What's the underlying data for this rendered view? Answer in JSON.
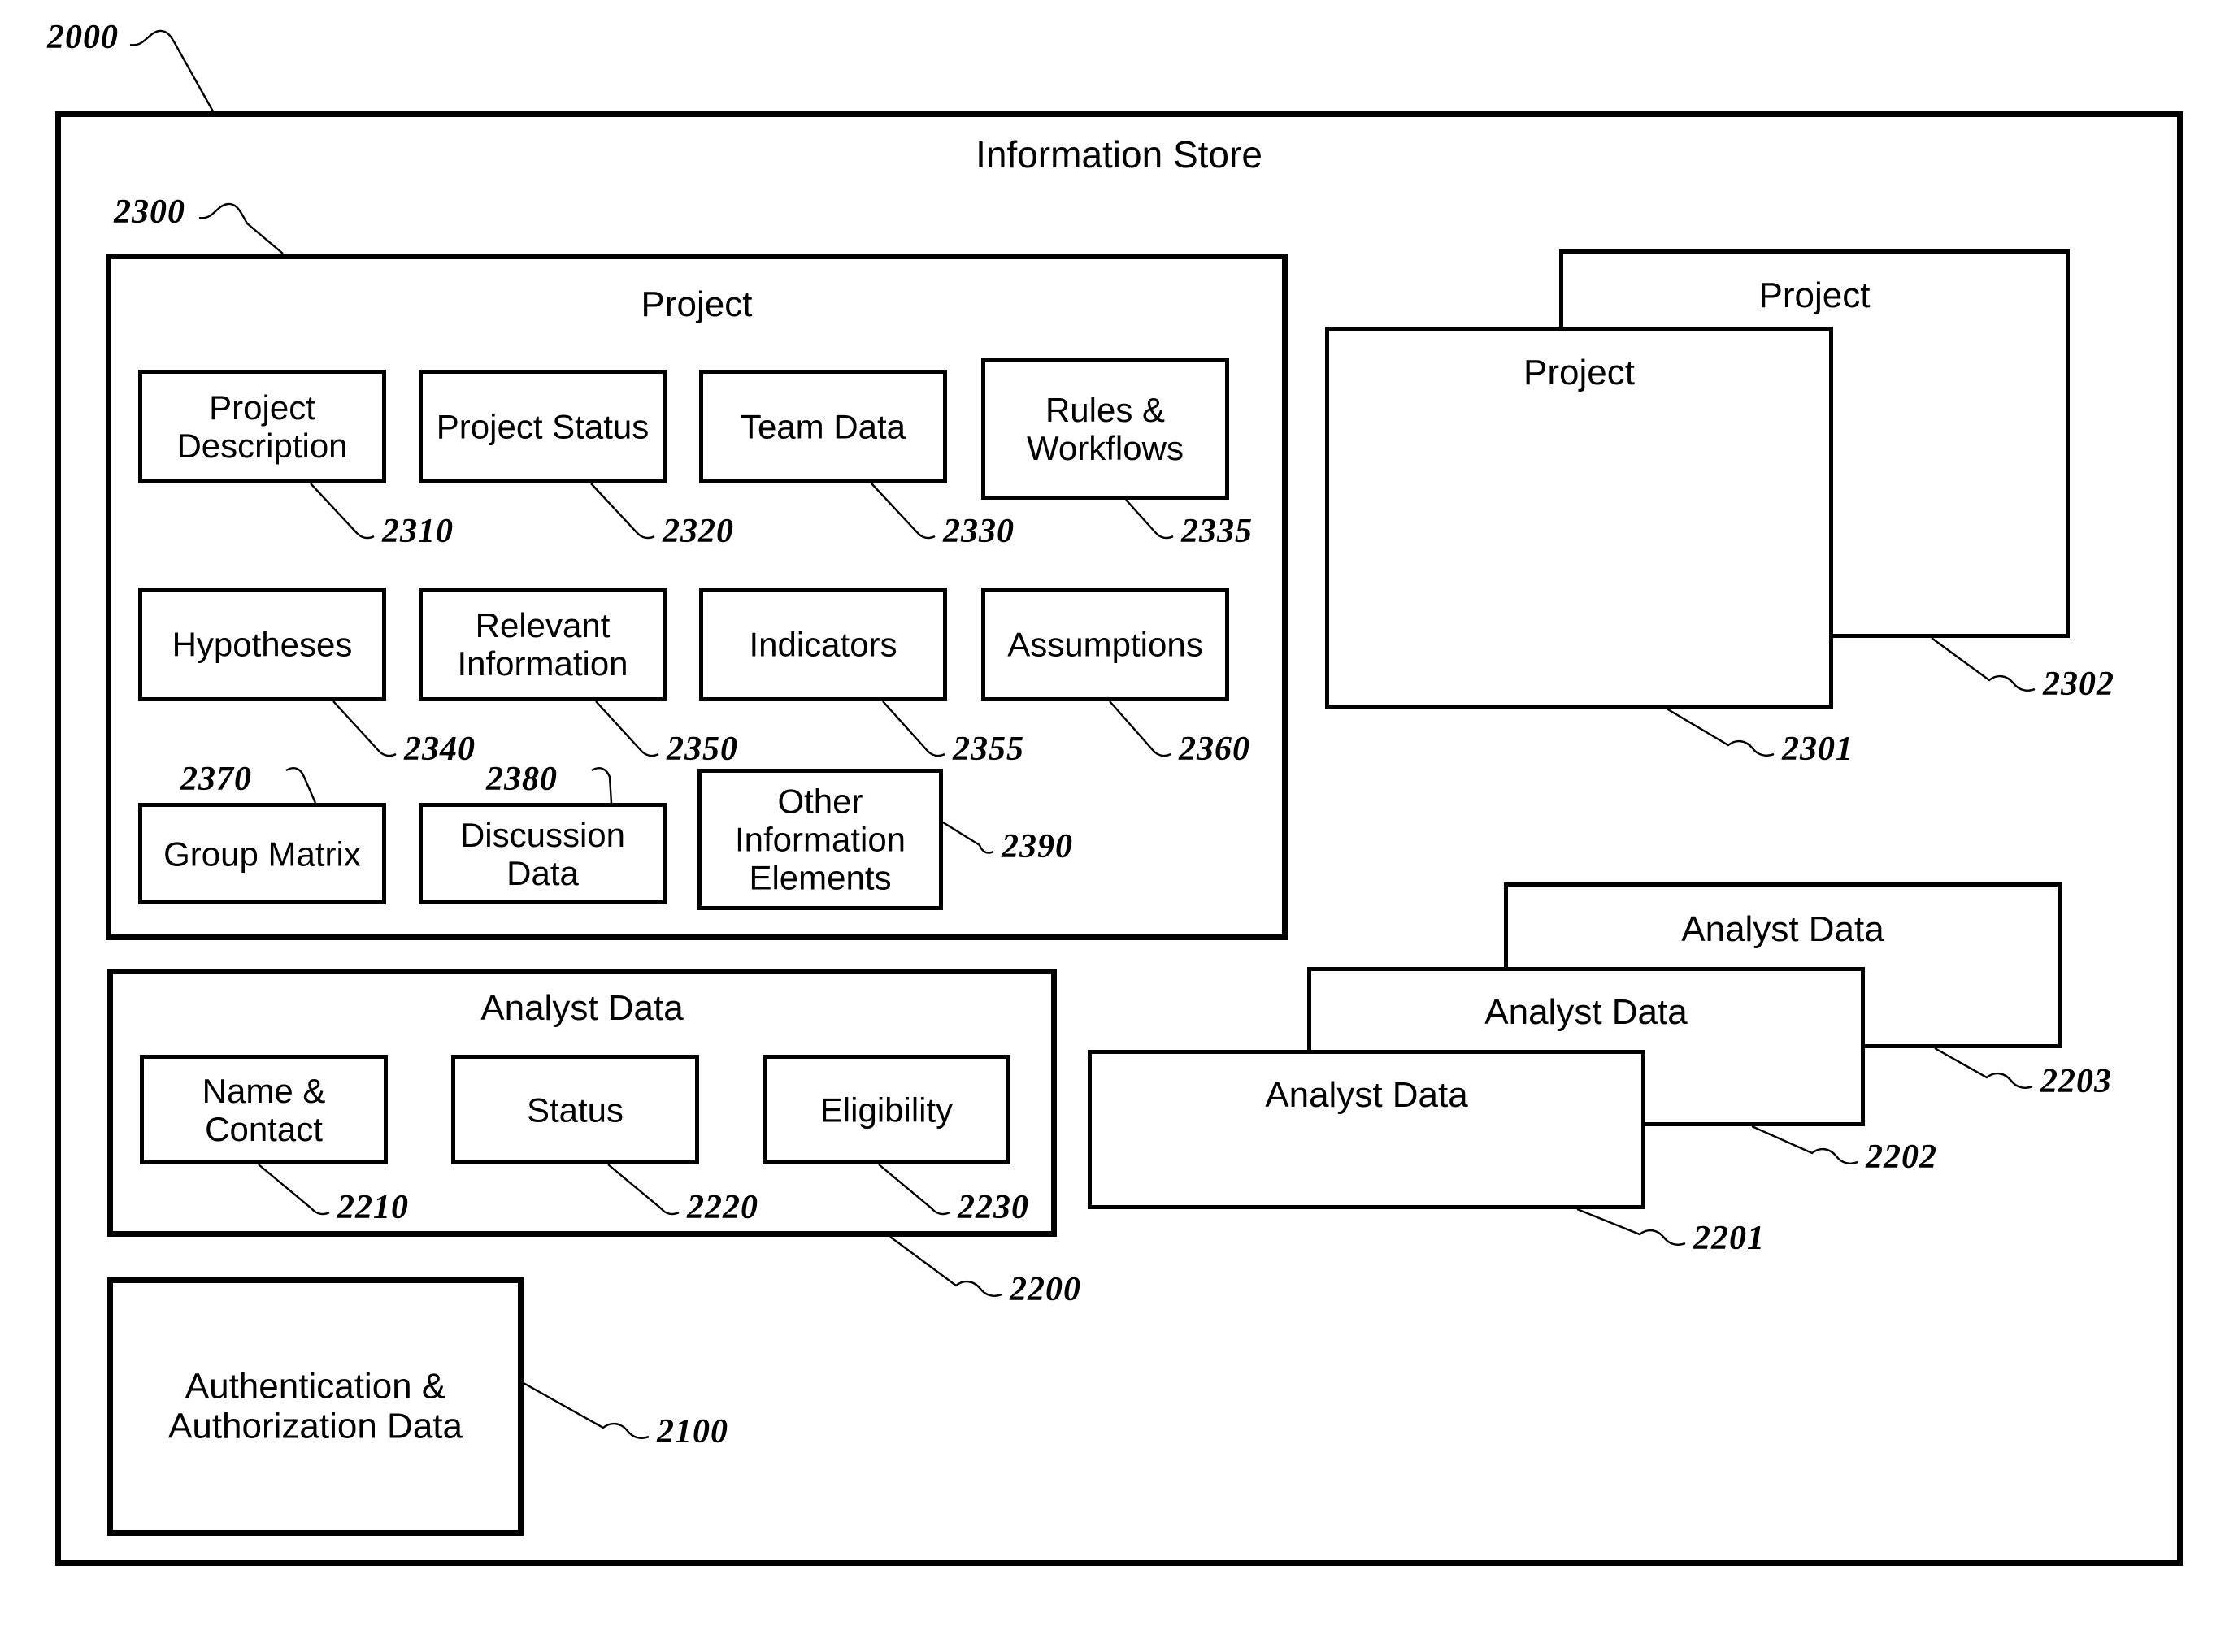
{
  "figure": {
    "outer_label": "2000",
    "information_store": {
      "title": "Information Store",
      "ref": null
    }
  },
  "project_container": {
    "title": "Project",
    "ref": "2300",
    "elements": [
      {
        "label": "Project Description",
        "ref": "2310"
      },
      {
        "label": "Project Status",
        "ref": "2320"
      },
      {
        "label": "Team Data",
        "ref": "2330"
      },
      {
        "label": "Rules & Workflows",
        "ref": "2335"
      },
      {
        "label": "Hypotheses",
        "ref": "2340"
      },
      {
        "label": "Relevant Information",
        "ref": "2350"
      },
      {
        "label": "Indicators",
        "ref": "2355"
      },
      {
        "label": "Assumptions",
        "ref": "2360"
      },
      {
        "label": "Group Matrix",
        "ref": "2370"
      },
      {
        "label": "Discussion Data",
        "ref": "2380"
      },
      {
        "label": "Other Information Elements",
        "ref": "2390"
      }
    ]
  },
  "analyst_container": {
    "title": "Analyst Data",
    "ref": "2200",
    "elements": [
      {
        "label": "Name & Contact",
        "ref": "2210"
      },
      {
        "label": "Status",
        "ref": "2220"
      },
      {
        "label": "Eligibility",
        "ref": "2230"
      }
    ]
  },
  "auth_box": {
    "label": "Authentication & Authorization Data",
    "ref": "2100"
  },
  "project_stack": [
    {
      "label": "Project",
      "ref": "2302"
    },
    {
      "label": "Project",
      "ref": "2301"
    }
  ],
  "analyst_stack": [
    {
      "label": "Analyst Data",
      "ref": "2203"
    },
    {
      "label": "Analyst Data",
      "ref": "2202"
    },
    {
      "label": "Analyst Data",
      "ref": "2201"
    }
  ],
  "colors": {
    "stroke": "#000000",
    "background": "#ffffff"
  }
}
